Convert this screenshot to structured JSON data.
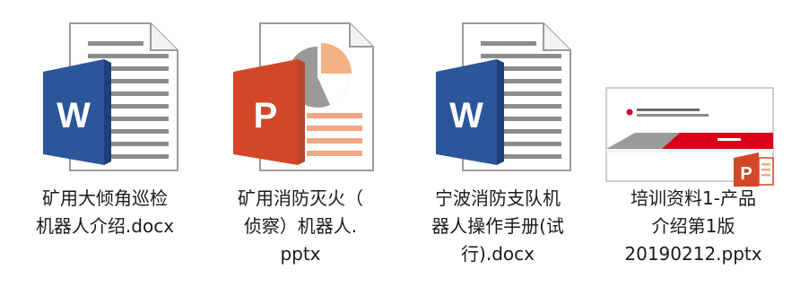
{
  "files": [
    {
      "name_lines": [
        "矿用大倾角巡检",
        "机器人介绍.docx"
      ],
      "type": "docx",
      "icon": "word-document-icon",
      "badge_letter": "W"
    },
    {
      "name_lines": [
        "矿用消防灭火（",
        "侦察）机器人.",
        "pptx"
      ],
      "type": "pptx",
      "icon": "powerpoint-document-icon",
      "badge_letter": "P"
    },
    {
      "name_lines": [
        "宁波消防支队机",
        "器人操作手册(试",
        "行).docx"
      ],
      "type": "docx",
      "icon": "word-document-icon",
      "badge_letter": "W"
    },
    {
      "name_lines": [
        "培训资料1-产品",
        "介绍第1版",
        "20190212.pptx"
      ],
      "type": "pptx",
      "icon": "powerpoint-slide-thumbnail",
      "badge_letter": "P"
    }
  ],
  "colors": {
    "word_blue": "#2b579a",
    "word_blue_dark": "#1e3f78",
    "ppt_orange": "#d24726",
    "ppt_orange_dark": "#b7472a",
    "slide_red": "#d9001b",
    "page_lines": "#8c8c8c"
  }
}
